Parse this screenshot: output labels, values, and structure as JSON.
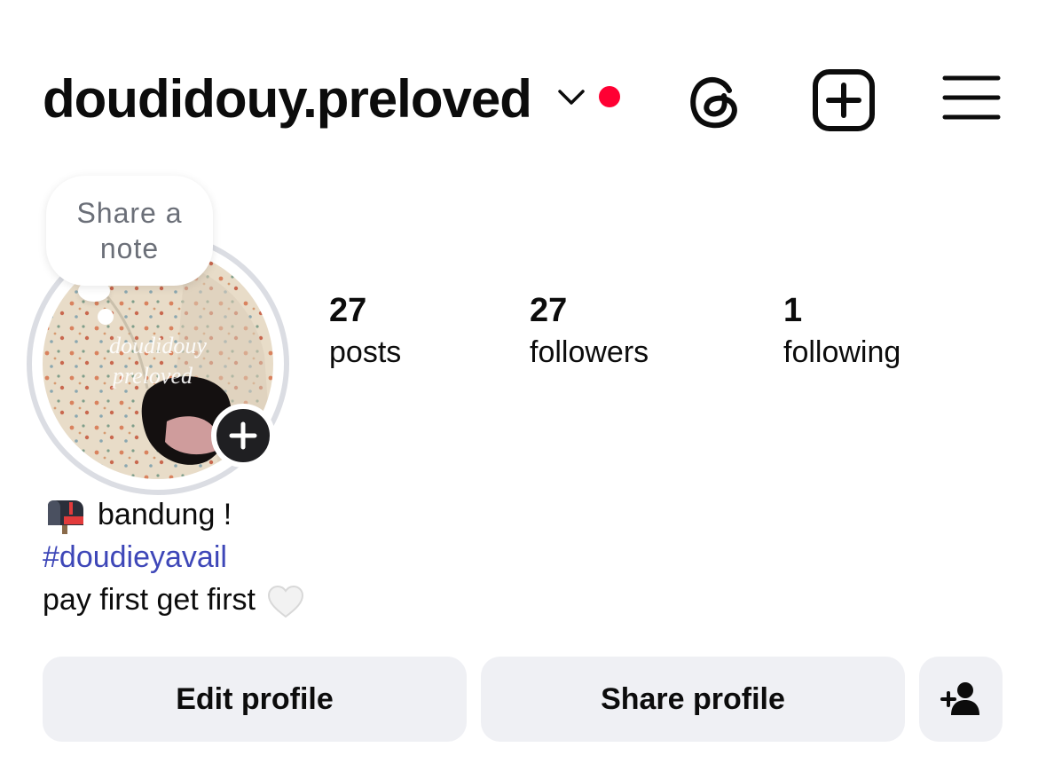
{
  "header": {
    "username": "doudidouy.preloved",
    "has_notification_dot": true,
    "dot_color": "#ff0033"
  },
  "icons": {
    "dropdown": "chevron-down-icon",
    "threads": "threads-icon",
    "new_post": "plus-square-icon",
    "menu": "hamburger-menu-icon",
    "add_story": "plus-icon",
    "suggested_people": "add-person-icon"
  },
  "note": {
    "text": "Share a note"
  },
  "avatar": {
    "overlay_line1": "doudidouy",
    "overlay_line2": "preloved"
  },
  "stats": [
    {
      "count": "27",
      "label": "posts"
    },
    {
      "count": "27",
      "label": "followers"
    },
    {
      "count": "1",
      "label": "following"
    }
  ],
  "bio": {
    "line1_emoji": "mailbox-icon",
    "line1_text": "bandung !",
    "line2_hashtag": "#doudieyavail",
    "line3_text": "pay first get first",
    "line3_emoji": "white-heart-icon"
  },
  "buttons": {
    "edit_profile": "Edit profile",
    "share_profile": "Share profile"
  },
  "colors": {
    "button_bg": "#eff0f4",
    "link": "#3e47b8",
    "text": "#0c0c0c"
  }
}
